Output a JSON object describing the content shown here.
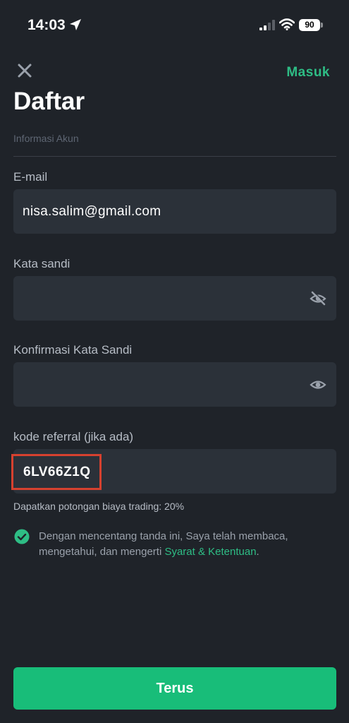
{
  "status": {
    "time": "14:03",
    "battery": "90"
  },
  "header": {
    "login_link": "Masuk",
    "title": "Daftar",
    "section": "Informasi Akun"
  },
  "form": {
    "email": {
      "label": "E-mail",
      "value": "nisa.salim@gmail.com"
    },
    "password": {
      "label": "Kata sandi",
      "value": ""
    },
    "confirm": {
      "label": "Konfirmasi Kata Sandi",
      "value": ""
    },
    "referral": {
      "label": "kode referral (jika ada)",
      "value": "6LV66Z1Q"
    },
    "discount": "Dapatkan potongan biaya trading: 20%",
    "terms": {
      "text": "Dengan mencentang tanda ini, Saya telah membaca, mengetahui, dan mengerti ",
      "link": "Syarat & Ketentuan",
      "end": "."
    }
  },
  "submit": "Terus",
  "colors": {
    "accent": "#2ebd85",
    "button": "#18bd79",
    "highlight": "#d6412f",
    "background": "#1f2329",
    "field": "#2b3139"
  },
  "icons": [
    "location-arrow-icon",
    "signal-icon",
    "wifi-icon",
    "close-icon",
    "eye-slash-icon",
    "eye-icon",
    "check-circle-icon"
  ]
}
